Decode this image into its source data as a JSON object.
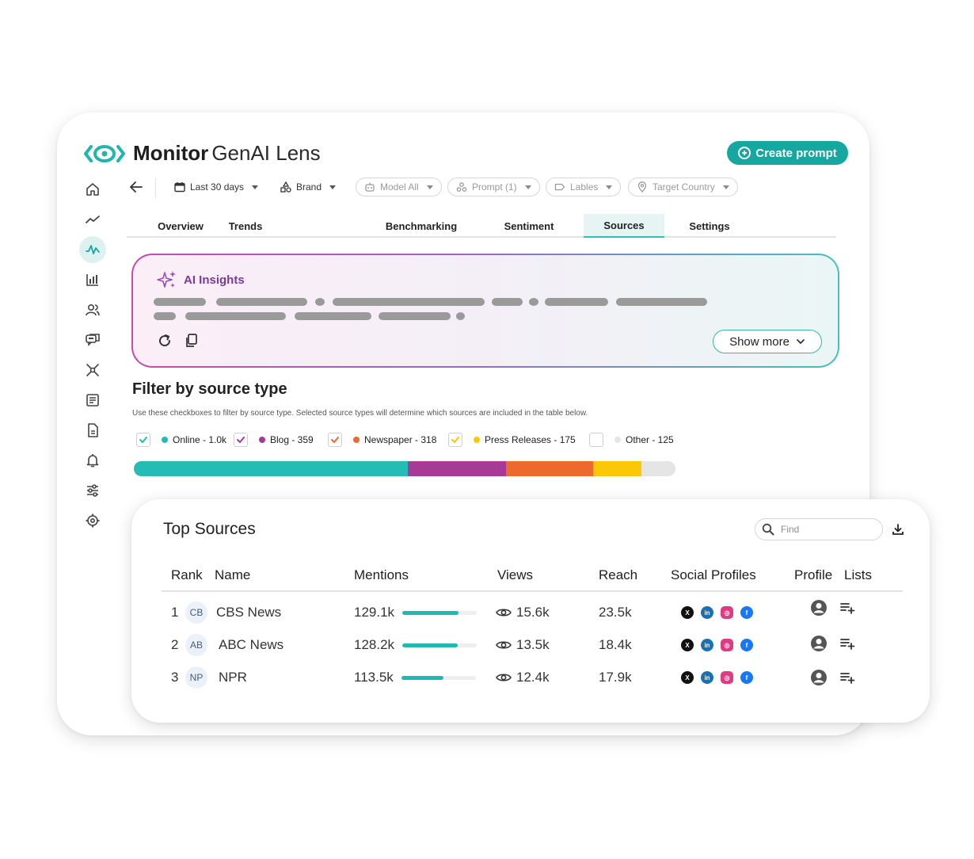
{
  "app": {
    "title_bold": "Monitor",
    "title_regular": "GenAI Lens",
    "create_button": "Create prompt",
    "accent_color": "#16a7a0"
  },
  "sidebar": {
    "items": [
      {
        "icon": "home-icon",
        "active": false
      },
      {
        "icon": "trend-line-icon",
        "active": false
      },
      {
        "icon": "pulse-icon",
        "active": true
      },
      {
        "icon": "bar-chart-icon",
        "active": false
      },
      {
        "icon": "users-icon",
        "active": false
      },
      {
        "icon": "chat-icon",
        "active": false
      },
      {
        "icon": "network-icon",
        "active": false
      },
      {
        "icon": "news-icon",
        "active": false
      },
      {
        "icon": "document-icon",
        "active": false
      },
      {
        "icon": "bell-icon",
        "active": false
      },
      {
        "icon": "sliders-icon",
        "active": false
      },
      {
        "icon": "settings-icon",
        "active": false
      }
    ]
  },
  "filters": {
    "date": "Last 30 days",
    "brand": "Brand",
    "model": "Model All",
    "prompt": "Prompt (1)",
    "labels": "Lables",
    "country": "Target Country"
  },
  "tabs": [
    {
      "label": "Overview",
      "active": false
    },
    {
      "label": "Trends",
      "active": false
    },
    {
      "label": "Benchmarking",
      "active": false
    },
    {
      "label": "Sentiment",
      "active": false
    },
    {
      "label": "Sources",
      "active": true
    },
    {
      "label": "Settings",
      "active": false
    }
  ],
  "ai_insights": {
    "title": "AI Insights",
    "show_more": "Show more"
  },
  "source_filter": {
    "title": "Filter by source type",
    "description": "Use these checkboxes to filter by source type. Selected source types will determine which sources are included in the table below.",
    "types": [
      {
        "label": "Online - 1.0k",
        "count": 1000,
        "color": "#25bcb5",
        "checked": true
      },
      {
        "label": "Blog - 359",
        "count": 359,
        "color": "#a83a97",
        "checked": true
      },
      {
        "label": "Newspaper - 318",
        "count": 318,
        "color": "#ec6a2c",
        "checked": true
      },
      {
        "label": "Press Releases - 175",
        "count": 175,
        "color": "#fbc808",
        "checked": true
      },
      {
        "label": "Other - 125",
        "count": 125,
        "color": "#e5e5e5",
        "checked": false
      }
    ]
  },
  "top_sources": {
    "title": "Top Sources",
    "search_placeholder": "Find",
    "columns": [
      "Rank",
      "Name",
      "Mentions",
      "Views",
      "Reach",
      "Social Profiles",
      "Profile",
      "Lists"
    ],
    "rows": [
      {
        "rank": "1",
        "abbr": "CB",
        "name": "CBS News",
        "mentions": "129.1k",
        "mentions_fraction": 0.75,
        "views": "15.6k",
        "reach": "23.5k"
      },
      {
        "rank": "2",
        "abbr": "AB",
        "name": "ABC News",
        "mentions": "128.2k",
        "mentions_fraction": 0.74,
        "views": "13.5k",
        "reach": "18.4k"
      },
      {
        "rank": "3",
        "abbr": "NP",
        "name": "NPR",
        "mentions": "113.5k",
        "mentions_fraction": 0.57,
        "views": "12.4k",
        "reach": "17.9k"
      }
    ]
  }
}
